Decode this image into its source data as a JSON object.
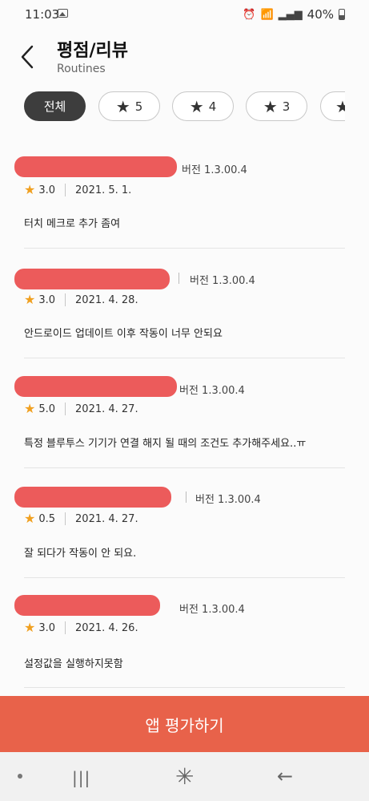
{
  "status": {
    "time": "11:03",
    "battery": "40%"
  },
  "header": {
    "title": "평점/리뷰",
    "subtitle": "Routines"
  },
  "filters": [
    {
      "label": "전체",
      "active": true
    },
    {
      "label": "5",
      "icon": "star-icon"
    },
    {
      "label": "4",
      "icon": "star-icon"
    },
    {
      "label": "3",
      "icon": "star-icon"
    }
  ],
  "reviews": [
    {
      "version": "버전 1.3.00.4",
      "rating": "3.0",
      "date": "2021. 5. 1.",
      "text": "터치 메크로 추가 좀여"
    },
    {
      "version": "버전 1.3.00.4",
      "rating": "3.0",
      "date": "2021. 4. 28.",
      "text": "안드로이드 업데이트 이후 작동이 너무 안되요"
    },
    {
      "version": "버전 1.3.00.4",
      "rating": "5.0",
      "date": "2021. 4. 27.",
      "text": "특정 블루투스 기기가 연결 해지 될 때의 조건도 추가해주세요..ㅠ"
    },
    {
      "version": "버전 1.3.00.4",
      "rating": "0.5",
      "date": "2021. 4. 27.",
      "text": "잘 되다가 작동이 안 되요."
    },
    {
      "version": "버전 1.3.00.4",
      "rating": "3.0",
      "date": "2021. 4. 26.",
      "text": "설정값을 실행하지못함"
    }
  ],
  "actions": {
    "rate_app": "앱 평가하기"
  },
  "colors": {
    "accent": "#e8624a",
    "redaction": "#ec5b5b",
    "star": "#f0a020"
  }
}
